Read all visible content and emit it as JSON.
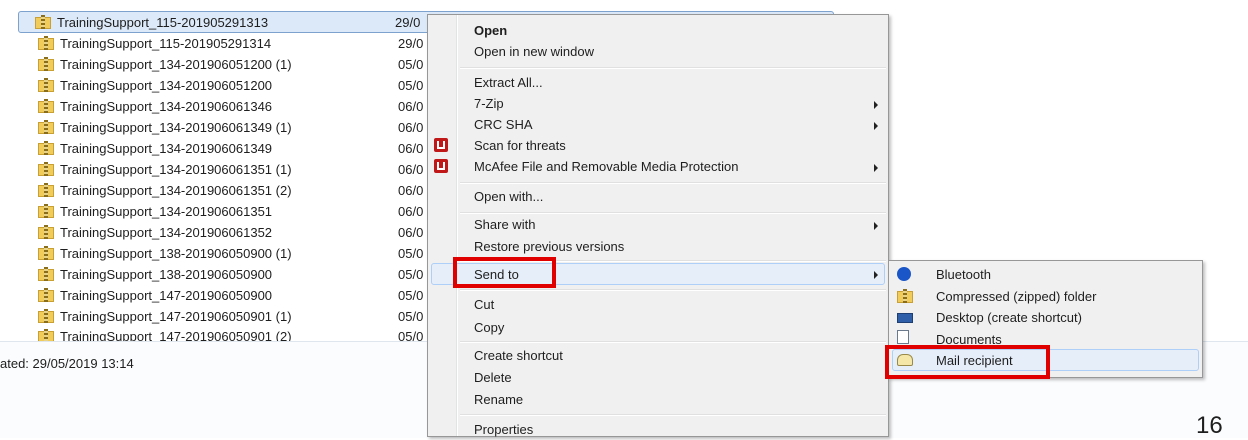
{
  "files": [
    {
      "name": "TrainingSupport_115-201905291313",
      "date": "29/0"
    },
    {
      "name": "TrainingSupport_115-201905291314",
      "date": "29/0"
    },
    {
      "name": "TrainingSupport_134-201906051200 (1)",
      "date": "05/0"
    },
    {
      "name": "TrainingSupport_134-201906051200",
      "date": "05/0"
    },
    {
      "name": "TrainingSupport_134-201906061346",
      "date": "06/0"
    },
    {
      "name": "TrainingSupport_134-201906061349 (1)",
      "date": "06/0"
    },
    {
      "name": "TrainingSupport_134-201906061349",
      "date": "06/0"
    },
    {
      "name": "TrainingSupport_134-201906061351 (1)",
      "date": "06/0"
    },
    {
      "name": "TrainingSupport_134-201906061351 (2)",
      "date": "06/0"
    },
    {
      "name": "TrainingSupport_134-201906061351",
      "date": "06/0"
    },
    {
      "name": "TrainingSupport_134-201906061352",
      "date": "06/0"
    },
    {
      "name": "TrainingSupport_138-201906050900 (1)",
      "date": "05/0"
    },
    {
      "name": "TrainingSupport_138-201906050900",
      "date": "05/0"
    },
    {
      "name": "TrainingSupport_147-201906050900",
      "date": "05/0"
    },
    {
      "name": "TrainingSupport_147-201906050901 (1)",
      "date": "05/0"
    },
    {
      "name": "TrainingSupport_147-201906050901 (2)",
      "date": "05/0"
    }
  ],
  "status": {
    "text": "ated: 29/05/2019 13:14"
  },
  "context_menu": {
    "open": "Open",
    "open_new_window": "Open in new window",
    "extract_all": "Extract All...",
    "seven_zip": "7-Zip",
    "crc_sha": "CRC SHA",
    "scan_threats": "Scan for threats",
    "mcafee": "McAfee File and Removable Media Protection",
    "open_with": "Open with...",
    "share_with": "Share with",
    "restore": "Restore previous versions",
    "send_to": "Send to",
    "cut": "Cut",
    "copy": "Copy",
    "create_shortcut": "Create shortcut",
    "delete": "Delete",
    "rename": "Rename",
    "properties": "Properties"
  },
  "send_to_menu": {
    "bluetooth": "Bluetooth",
    "compressed": "Compressed (zipped) folder",
    "desktop": "Desktop (create shortcut)",
    "documents": "Documents",
    "mail": "Mail recipient"
  },
  "page_number": "16",
  "colors": {
    "highlight_box": "#e00000",
    "selection": "#dce9f8"
  }
}
